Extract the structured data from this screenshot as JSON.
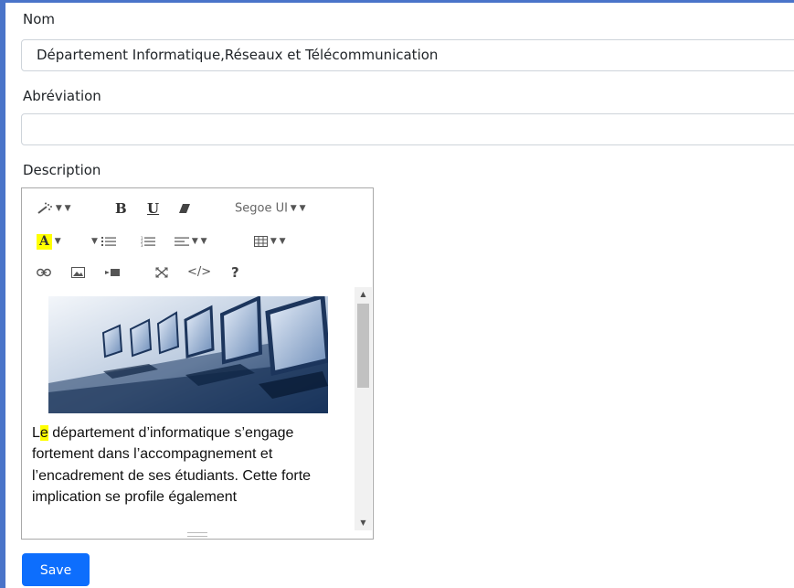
{
  "form": {
    "nom_label": "Nom",
    "nom_value": "Département Informatique,Réseaux et Télécommunication",
    "abreviation_label": "Abréviation",
    "abreviation_value": "",
    "description_label": "Description",
    "save_label": "Save"
  },
  "editor": {
    "toolbar": {
      "font_name": "Segoe UI",
      "row1": [
        "magic-wand-icon",
        "bold-icon",
        "underline-icon",
        "eraser-icon",
        "font-name-dropdown"
      ],
      "row2": [
        "font-color-icon",
        "unordered-list-icon",
        "ordered-list-icon",
        "paragraph-align-icon",
        "table-icon"
      ],
      "row3": [
        "link-icon",
        "picture-icon",
        "video-icon",
        "fullscreen-icon",
        "code-view-icon",
        "help-icon"
      ]
    },
    "content": {
      "first_letter": "L",
      "highlighted_letter": "e",
      "rest_text": " département d’informatique s’engage fortement dans l’accompagnement et l’encadrement de ses étudiants. Cette forte implication se profile également"
    }
  },
  "colors": {
    "accent": "#0d6efd",
    "frame": "#4a74c9",
    "highlight": "#ffff00",
    "border": "#ced4da"
  }
}
